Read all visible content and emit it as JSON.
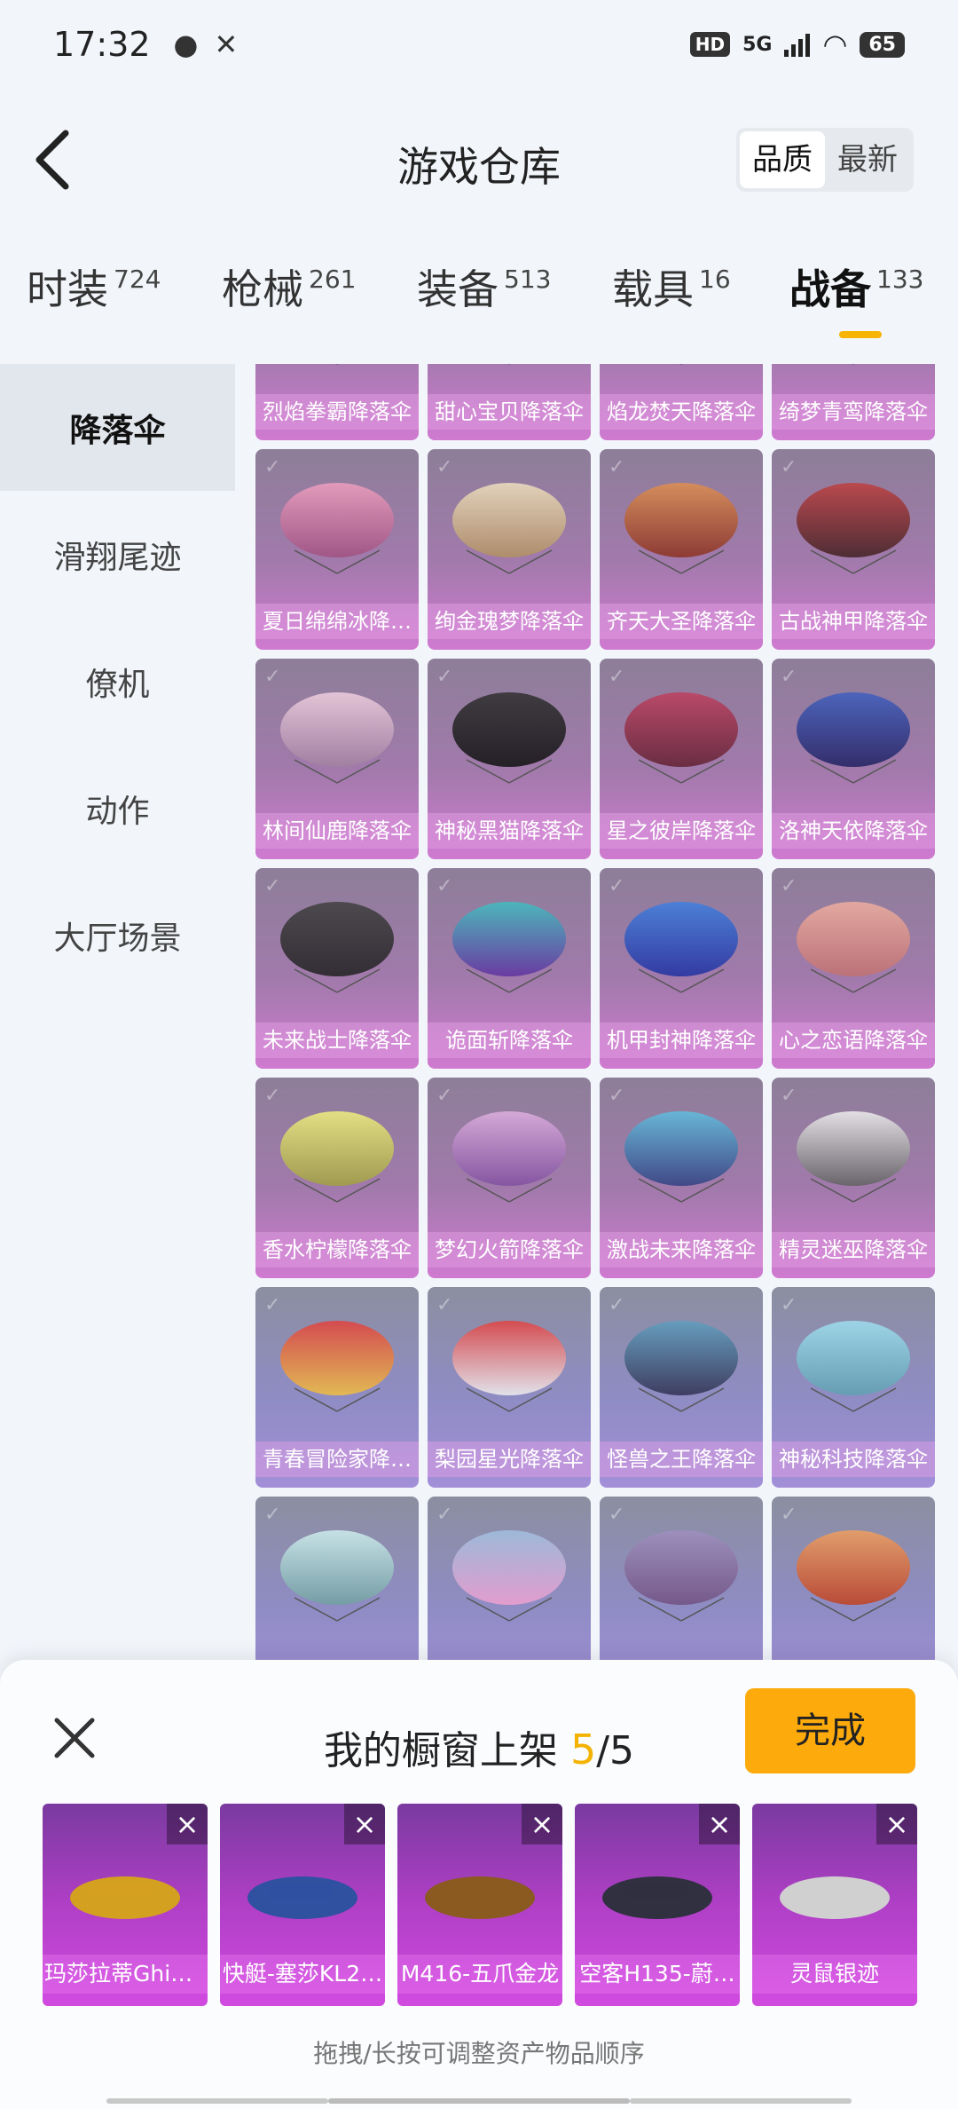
{
  "status": {
    "time": "17:32",
    "hd": "HD",
    "network": "5G",
    "battery": "65"
  },
  "header": {
    "title": "游戏仓库",
    "sort_options": [
      "品质",
      "最新"
    ]
  },
  "tabs": [
    {
      "label": "时装",
      "count": "724"
    },
    {
      "label": "枪械",
      "count": "261"
    },
    {
      "label": "装备",
      "count": "513"
    },
    {
      "label": "载具",
      "count": "16"
    },
    {
      "label": "战备",
      "count": "133"
    }
  ],
  "sidebar": {
    "items": [
      "降落伞",
      "滑翔尾迹",
      "僚机",
      "动作",
      "大厅场景"
    ]
  },
  "grid": {
    "items": [
      "烈焰拳霸降落伞",
      "甜心宝贝降落伞",
      "焰龙焚天降落伞",
      "绮梦青鸾降落伞",
      "夏日绵绵冰降…",
      "绚金瑰梦降落伞",
      "齐天大圣降落伞",
      "古战神甲降落伞",
      "林间仙鹿降落伞",
      "神秘黑猫降落伞",
      "星之彼岸降落伞",
      "洛神天依降落伞",
      "未来战士降落伞",
      "诡面斩降落伞",
      "机甲封神降落伞",
      "心之恋语降落伞",
      "香水柠檬降落伞",
      "梦幻火箭降落伞",
      "激战未来降落伞",
      "精灵迷巫降落伞",
      "青春冒险家降…",
      "梨园星光降落伞",
      "怪兽之王降落伞",
      "神秘科技降落伞",
      "",
      "",
      "",
      ""
    ]
  },
  "sheet": {
    "title": "我的橱窗上架",
    "count_current": "5",
    "count_total": "/5",
    "done_label": "完成",
    "shelf_items": [
      "玛莎拉蒂Ghibl…",
      "快艇-塞莎KL2…",
      "M416-五爪金龙",
      "空客H135-蔚…",
      "灵鼠银迹"
    ],
    "hint": "拖拽/长按可调整资产物品顺序"
  },
  "colors": {
    "accent": "#f7b400",
    "done_button": "#fcaa0c",
    "item_bg": "#b03fc6"
  }
}
